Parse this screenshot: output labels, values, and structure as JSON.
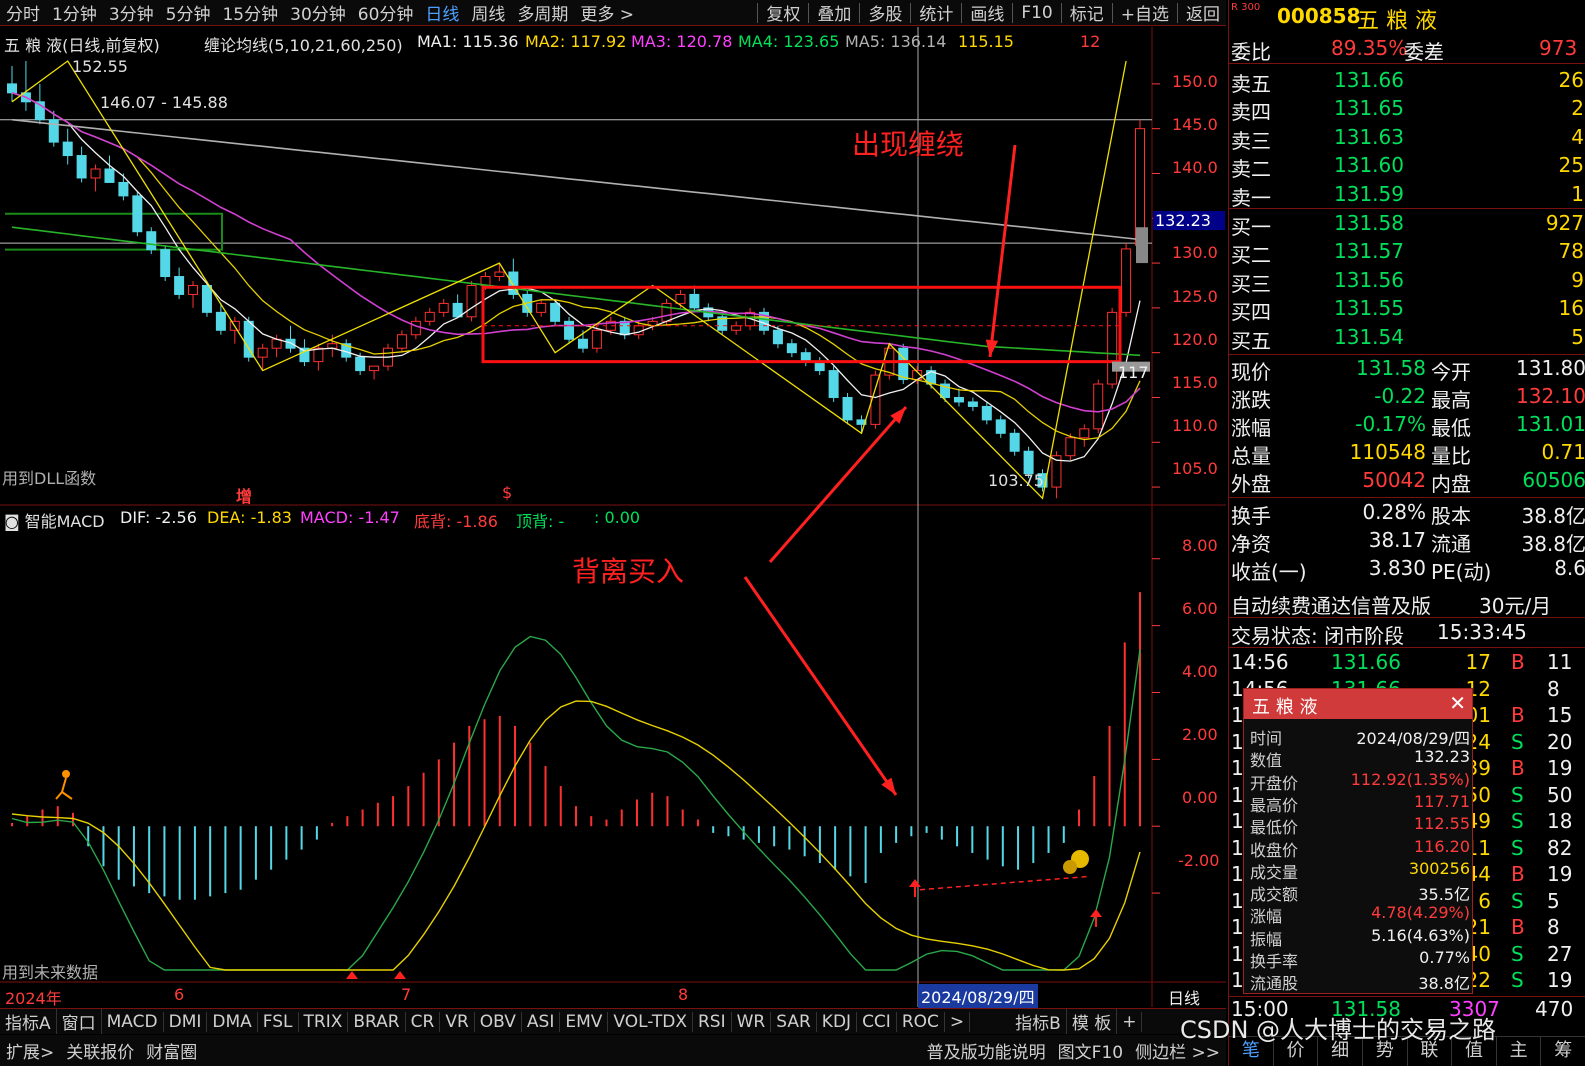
{
  "toolbar": {
    "periods": [
      "分时",
      "1分钟",
      "3分钟",
      "5分钟",
      "15分钟",
      "30分钟",
      "60分钟",
      "日线",
      "周线",
      "多周期",
      "更多 >"
    ],
    "selected_period": "日线",
    "actions": [
      "复权",
      "叠加",
      "多股",
      "统计",
      "画线",
      "F10",
      "标记",
      "+自选",
      "返回"
    ]
  },
  "main_header": {
    "title": "五 粮 液(日线,前复权)",
    "indicator": "缠论均线(5,10,21,60,250)",
    "ma1": "MA1: 115.36",
    "ma2": "MA2: 117.92",
    "ma3": "MA3: 120.78",
    "ma4": "MA4: 123.65",
    "ma5": "MA5: 136.14",
    "ma6": "115.15",
    "count": "12"
  },
  "price_labels": {
    "high": "152.55",
    "mid": "146.07 - 145.88",
    "low": "103.75",
    "current_tag": "132.23",
    "left_note": "117"
  },
  "price_axis": [
    "150.0",
    "145.0",
    "140.0",
    "135.0",
    "130.0",
    "125.0",
    "120.0",
    "115.0",
    "110.0",
    "105.0"
  ],
  "notes": {
    "dll": "用到DLL函数",
    "future": "用到未来数据",
    "zeng": "增",
    "s": "$"
  },
  "macd_header": {
    "title": "智能MACD",
    "dif": "DIF: -2.56",
    "dea": "DEA: -1.83",
    "macd": "MACD: -1.47",
    "bottom": "底背: -1.86",
    "top": "顶背: -",
    "other": ": 0.00"
  },
  "macd_axis": [
    "8.00",
    "6.00",
    "4.00",
    "2.00",
    "0.00",
    "-2.00"
  ],
  "date_axis": {
    "year": "2024年",
    "m6": "6",
    "m7": "7",
    "m8": "8",
    "cursor": "2024/08/29/四",
    "period": "日线"
  },
  "annotations": {
    "wrap": "出现缠绕",
    "diverge": "背离买入"
  },
  "chart_data": {
    "type": "candlestick",
    "title": "五 粮 液(日线,前复权)",
    "stock": "五粮液 000858",
    "ylim": [
      103,
      153
    ],
    "candles": [
      [
        150,
        152,
        148,
        149
      ],
      [
        149,
        152.55,
        147,
        148
      ],
      [
        148,
        150,
        145.5,
        146
      ],
      [
        146,
        147,
        143,
        143.5
      ],
      [
        143.5,
        145,
        141,
        142
      ],
      [
        142,
        143,
        139,
        139.5
      ],
      [
        139.5,
        141,
        138,
        140.5
      ],
      [
        140.5,
        142,
        139,
        139
      ],
      [
        139,
        140,
        137,
        137.5
      ],
      [
        137.5,
        138,
        133,
        133.5
      ],
      [
        133.5,
        134,
        131,
        131.5
      ],
      [
        131.5,
        132,
        128,
        128.5
      ],
      [
        128.5,
        129.5,
        126,
        126.5
      ],
      [
        126.5,
        128,
        125,
        127.5
      ],
      [
        127.5,
        128,
        124,
        124.5
      ],
      [
        124.5,
        125.5,
        122,
        122.5
      ],
      [
        122.5,
        124,
        121,
        123.5
      ],
      [
        123.5,
        124,
        119,
        119.5
      ],
      [
        119.5,
        121,
        118,
        120.5
      ],
      [
        120.5,
        122,
        119.5,
        121.5
      ],
      [
        121.5,
        123,
        120,
        120.5
      ],
      [
        120.5,
        121.5,
        118.5,
        119
      ],
      [
        119,
        121,
        118,
        120.5
      ],
      [
        120.5,
        122,
        119.5,
        121
      ],
      [
        121,
        121.5,
        119,
        119.5
      ],
      [
        119.5,
        120,
        117.5,
        118
      ],
      [
        118,
        118.5,
        117,
        118.5
      ],
      [
        118.5,
        121,
        118,
        120.5
      ],
      [
        120.5,
        122.5,
        120,
        122
      ],
      [
        122,
        124,
        121.5,
        123.5
      ],
      [
        123.5,
        125,
        123,
        124.5
      ],
      [
        124.5,
        126,
        124,
        125.5
      ],
      [
        125.5,
        126.5,
        124,
        124
      ],
      [
        124,
        128,
        123.5,
        127.5
      ],
      [
        127.5,
        129,
        127,
        128.5
      ],
      [
        128.5,
        130,
        128,
        129
      ],
      [
        129,
        130.5,
        126,
        126.5
      ],
      [
        126.5,
        127,
        124,
        124.5
      ],
      [
        124.5,
        126,
        124,
        125.5
      ],
      [
        125.5,
        126,
        123,
        123.5
      ],
      [
        123.5,
        124,
        121,
        121.5
      ],
      [
        121.5,
        122.5,
        120,
        120.5
      ],
      [
        120.5,
        123,
        120,
        122.5
      ],
      [
        122.5,
        124,
        122,
        123.5
      ],
      [
        123.5,
        124,
        121.5,
        122
      ],
      [
        122,
        123.5,
        121.5,
        123
      ],
      [
        123,
        124,
        122.5,
        123.5
      ],
      [
        123.5,
        126,
        123,
        125.5
      ],
      [
        125.5,
        127,
        125,
        126.5
      ],
      [
        126.5,
        127.5,
        124.5,
        125
      ],
      [
        125,
        125.5,
        123.5,
        124
      ],
      [
        124,
        124.5,
        122,
        122.5
      ],
      [
        122.5,
        123.5,
        122,
        123
      ],
      [
        123,
        125,
        122.5,
        124.5
      ],
      [
        124.5,
        125,
        122,
        122.5
      ],
      [
        122.5,
        123,
        120.5,
        121
      ],
      [
        121,
        121.5,
        119.5,
        120
      ],
      [
        120,
        120.5,
        118.5,
        119
      ],
      [
        119,
        119.5,
        117.5,
        118
      ],
      [
        118,
        118.5,
        114.5,
        115
      ],
      [
        115,
        115.5,
        112,
        112.5
      ],
      [
        112.5,
        113,
        111,
        112
      ],
      [
        112,
        118,
        111.5,
        117.5
      ],
      [
        117.5,
        121,
        117,
        120.5
      ],
      [
        120.5,
        121,
        116.5,
        117
      ],
      [
        117,
        118.5,
        116.5,
        118
      ],
      [
        118,
        118.5,
        116,
        116.5
      ],
      [
        116.5,
        117,
        114.5,
        115
      ],
      [
        115,
        116,
        114,
        114.5
      ],
      [
        114.5,
        115,
        113.5,
        114
      ],
      [
        114,
        114.5,
        112,
        112.5
      ],
      [
        112.5,
        113,
        110.5,
        111
      ],
      [
        111,
        111.5,
        108.5,
        109
      ],
      [
        109,
        109.5,
        106,
        106.5
      ],
      [
        106.5,
        107,
        104.5,
        105
      ],
      [
        105,
        109,
        103.75,
        108.5
      ],
      [
        108.5,
        111,
        108,
        110.5
      ],
      [
        110.5,
        112,
        109.5,
        111.5
      ],
      [
        111.5,
        117,
        111,
        116.5
      ],
      [
        116.5,
        125,
        116,
        124.5
      ],
      [
        124.5,
        132.23,
        124,
        131.58
      ],
      [
        132,
        146,
        131,
        145
      ]
    ],
    "macd_hist": [
      0.1,
      0.3,
      0.5,
      0.6,
      0.4,
      -0.6,
      -1.2,
      -1.6,
      -1.8,
      -2.0,
      -2.1,
      -2.2,
      -2.2,
      -2.1,
      -2.0,
      -1.9,
      -1.6,
      -1.3,
      -1.0,
      -0.7,
      -0.4,
      0.1,
      0.3,
      0.5,
      0.7,
      0.9,
      1.2,
      1.6,
      2.0,
      2.5,
      3.0,
      3.2,
      3.3,
      3.0,
      2.5,
      1.8,
      1.2,
      0.6,
      0.3,
      0.2,
      0.5,
      0.8,
      1.0,
      0.9,
      0.5,
      0.2,
      -0.2,
      -0.3,
      -0.4,
      -0.5,
      -0.6,
      -0.7,
      -0.9,
      -1.1,
      -1.3,
      -1.5,
      -1.7,
      -0.8,
      -0.5,
      -0.3,
      -0.2,
      -0.4,
      -0.6,
      -0.8,
      -1.0,
      -1.2,
      -1.3,
      -1.1,
      -0.8,
      -0.5,
      0.5,
      1.5,
      3.0,
      5.5,
      7.0
    ]
  },
  "quote": {
    "prefix": "R 300",
    "code": "000858",
    "name": "五 粮 液",
    "wb_label": "委比",
    "wb": "89.35%",
    "wc_label": "委差",
    "wc": "973",
    "sell": [
      {
        "l": "卖五",
        "p": "131.66",
        "v": "26"
      },
      {
        "l": "卖四",
        "p": "131.65",
        "v": "2"
      },
      {
        "l": "卖三",
        "p": "131.63",
        "v": "4"
      },
      {
        "l": "卖二",
        "p": "131.60",
        "v": "25"
      },
      {
        "l": "卖一",
        "p": "131.59",
        "v": "1"
      }
    ],
    "buy": [
      {
        "l": "买一",
        "p": "131.58",
        "v": "927"
      },
      {
        "l": "买二",
        "p": "131.57",
        "v": "78"
      },
      {
        "l": "买三",
        "p": "131.56",
        "v": "9"
      },
      {
        "l": "买四",
        "p": "131.55",
        "v": "16"
      },
      {
        "l": "买五",
        "p": "131.54",
        "v": "5"
      }
    ],
    "stats": [
      {
        "k1": "现价",
        "v1": "131.58",
        "k2": "今开",
        "v2": "131.80"
      },
      {
        "k1": "涨跌",
        "v1": "-0.22",
        "k2": "最高",
        "v2": "132.10"
      },
      {
        "k1": "涨幅",
        "v1": "-0.17%",
        "k2": "最低",
        "v2": "131.01"
      },
      {
        "k1": "总量",
        "v1": "110548",
        "k2": "量比",
        "v2": "0.71"
      },
      {
        "k1": "外盘",
        "v1": "50042",
        "k2": "内盘",
        "v2": "60506"
      }
    ],
    "stats2": [
      {
        "k1": "换手",
        "v1": "0.28%",
        "k2": "股本",
        "v2": "38.8亿"
      },
      {
        "k1": "净资",
        "v1": "38.17",
        "k2": "流通",
        "v2": "38.8亿"
      },
      {
        "k1": "收益(一)",
        "v1": "3.830",
        "k2": "PE(动)",
        "v2": "8.6"
      }
    ],
    "promo": "自动续费通达信普及版",
    "promo_price": "30元/月",
    "state_label": "交易状态: 闭市阶段",
    "state_time": "15:33:45",
    "ticks": [
      {
        "t": "14:56",
        "p": "131.66",
        "v": "17",
        "s": "B",
        "n": "11"
      },
      {
        "t": "14:56",
        "p": "131.66",
        "v": "12",
        "s": "",
        "n": "8"
      },
      {
        "t": "1",
        "p": "",
        "v": "01",
        "s": "B",
        "n": "15"
      },
      {
        "t": "1",
        "p": "",
        "v": "24",
        "s": "S",
        "n": "20"
      },
      {
        "t": "1",
        "p": "",
        "v": "39",
        "s": "B",
        "n": "19"
      },
      {
        "t": "1",
        "p": "",
        "v": "50",
        "s": "S",
        "n": "50"
      },
      {
        "t": "1",
        "p": "",
        "v": "49",
        "s": "S",
        "n": "18"
      },
      {
        "t": "1",
        "p": "",
        "v": "11",
        "s": "S",
        "n": "82"
      },
      {
        "t": "1",
        "p": "",
        "v": "44",
        "s": "B",
        "n": "19"
      },
      {
        "t": "1",
        "p": "",
        "v": "6",
        "s": "S",
        "n": "5"
      },
      {
        "t": "1",
        "p": "",
        "v": "21",
        "s": "B",
        "n": "8"
      },
      {
        "t": "1",
        "p": "",
        "v": "40",
        "s": "S",
        "n": "27"
      },
      {
        "t": "1",
        "p": "",
        "v": "22",
        "s": "S",
        "n": "19"
      }
    ],
    "last_tick": {
      "t": "15:00",
      "p": "131.58",
      "v": "3307",
      "n": "470"
    },
    "bottom_tabs": [
      "笔",
      "价",
      "细",
      "势",
      "联",
      "值",
      "主",
      "筹"
    ]
  },
  "popup": {
    "title": "五 粮 液",
    "rows": [
      {
        "k": "时间",
        "v": "2024/08/29/四",
        "c": "#f0f0f0"
      },
      {
        "k": "数值",
        "v": "132.23",
        "c": "#f0f0f0"
      },
      {
        "k": "开盘价",
        "v": "112.92(1.35%)",
        "c": "#ff3b3b"
      },
      {
        "k": "最高价",
        "v": "117.71",
        "c": "#ff3b3b"
      },
      {
        "k": "最低价",
        "v": "112.55",
        "c": "#ff3b3b"
      },
      {
        "k": "收盘价",
        "v": "116.20",
        "c": "#ff3b3b"
      },
      {
        "k": "成交量",
        "v": "300256",
        "c": "#ffd800"
      },
      {
        "k": "成交额",
        "v": "35.5亿",
        "c": "#f0f0f0"
      },
      {
        "k": "涨幅",
        "v": "4.78(4.29%)",
        "c": "#ff3b3b"
      },
      {
        "k": "振幅",
        "v": "5.16(4.63%)",
        "c": "#f0f0f0"
      },
      {
        "k": "换手率",
        "v": "0.77%",
        "c": "#f0f0f0"
      },
      {
        "k": "流通股",
        "v": "38.8亿",
        "c": "#f0f0f0"
      }
    ]
  },
  "bottom_tabs": [
    "指标A",
    "窗口",
    "MACD",
    "DMI",
    "DMA",
    "FSL",
    "TRIX",
    "BRAR",
    "CR",
    "VR",
    "OBV",
    "ASI",
    "EMV",
    "VOL-TDX",
    "RSI",
    "WR",
    "SAR",
    "KDJ",
    "CCI",
    "ROC",
    ">",
    "指标B",
    "模 板",
    "+"
  ],
  "bottom_tabs2": [
    "扩展>",
    "关联报价",
    "财富圈"
  ],
  "bottom_right": {
    "help": "普及版功能说明",
    "f10": "图文F10",
    "sidebar": "侧边栏 >>"
  },
  "watermark": "CSDN @人大博士的交易之路"
}
